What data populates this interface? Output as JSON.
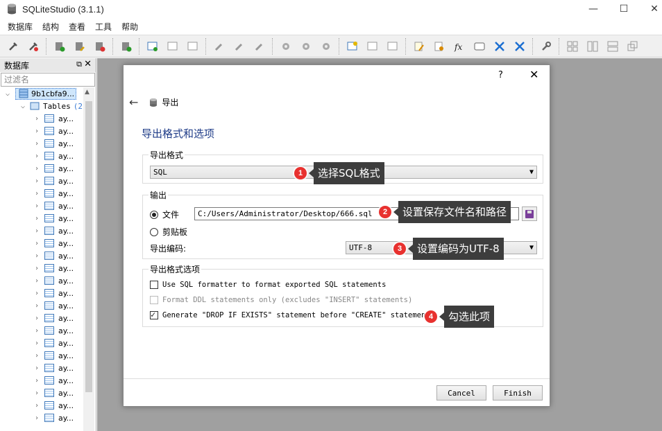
{
  "window": {
    "title": "SQLiteStudio (3.1.1)",
    "min": "—",
    "max": "☐",
    "close": "✕"
  },
  "menu": [
    "数据库",
    "结构",
    "查看",
    "工具",
    "帮助"
  ],
  "left_panel": {
    "title": "数据库",
    "pin": "⧉",
    "close": "✕",
    "filter_placeholder": "过滤名",
    "db_name": "9b1cbfa9...",
    "tables_label": "Tables",
    "tables_count": "(2",
    "table_items": [
      "ay...",
      "ay...",
      "ay...",
      "ay...",
      "ay...",
      "ay...",
      "ay...",
      "ay...",
      "ay...",
      "ay...",
      "ay...",
      "ay...",
      "ay...",
      "ay...",
      "ay...",
      "ay...",
      "ay...",
      "ay...",
      "ay...",
      "ay...",
      "ay...",
      "ay...",
      "ay...",
      "ay...",
      "ay..."
    ]
  },
  "dialog": {
    "help": "?",
    "close": "✕",
    "back": "←",
    "nav_label": "导出",
    "section_title": "导出格式和选项",
    "format_group": "导出格式",
    "format_value": "SQL",
    "output_group": "输出",
    "file_label": "文件",
    "file_path": "C:/Users/Administrator/Desktop/666.sql",
    "clipboard_label": "剪贴板",
    "encoding_label": "导出编码:",
    "encoding_value": "UTF-8",
    "options_group": "导出格式选项",
    "opt1": "Use SQL formatter to format exported SQL statements",
    "opt2": "Format DDL statements only (excludes \"INSERT\" statements)",
    "opt3": "Generate \"DROP IF EXISTS\" statement before \"CREATE\" statement",
    "cancel": "Cancel",
    "finish": "Finish"
  },
  "annotations": {
    "a1_num": "1",
    "a1_text": "选择SQL格式",
    "a2_num": "2",
    "a2_text": "设置保存文件名和路径",
    "a3_num": "3",
    "a3_text": "设置编码为UTF-8",
    "a4_num": "4",
    "a4_text": "勾选此项"
  },
  "colors": {
    "annotation_badge": "#e8312f",
    "annotation_tip": "#3d3d3d",
    "section_title": "#1f3c88"
  }
}
